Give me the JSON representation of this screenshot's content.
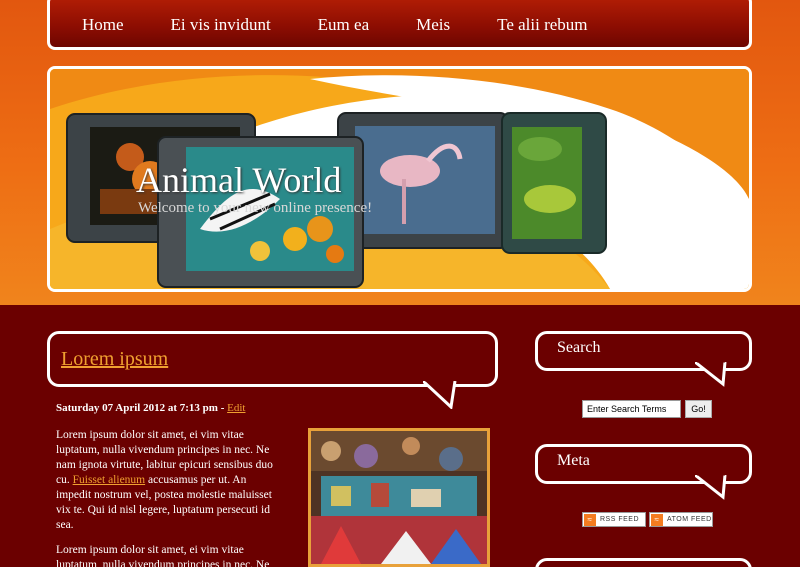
{
  "nav": {
    "items": [
      "Home",
      "Ei vis invidunt",
      "Eum ea",
      "Meis",
      "Te alii rebum"
    ]
  },
  "header": {
    "title": "Animal World",
    "subtitle": "Welcome to your new online presence!"
  },
  "post": {
    "title": "Lorem ipsum",
    "meta": "Saturday 07 April 2012 at 7:13 pm - ",
    "edit_label": "Edit",
    "para1_before": "Lorem ipsum dolor sit amet, ei vim vitae luptatum, nulla vivendum principes in nec. Ne nam ignota virtute, labitur epicuri sensibus duo cu. ",
    "para1_link": "Fuisset alienum",
    "para1_after": " accusamus per ut. An impedit nostrum vel, postea molestie maluisset vix te. Qui id nisl legere, luptatum persecuti id sea.",
    "para2": "Lorem ipsum dolor sit amet, ei vim vitae luptatum, nulla vivendum principes in nec. Ne"
  },
  "sidebar": {
    "search_title": "Search",
    "search_value": "Enter Search Terms",
    "search_button": "Go!",
    "meta_title": "Meta",
    "rss_label": "RSS FEED",
    "atom_label": "ATOM FEED"
  },
  "colors": {
    "orange": "#ee6e14",
    "dark_red": "#6b0000",
    "link": "#f0a030"
  }
}
